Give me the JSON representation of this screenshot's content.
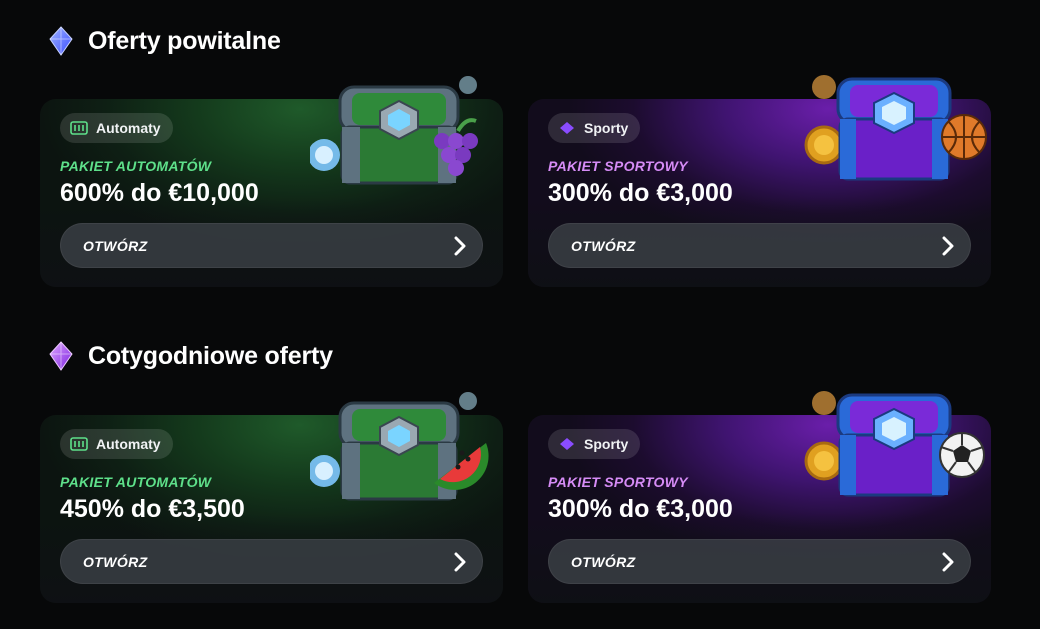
{
  "sections": [
    {
      "title": "Oferty powitalne",
      "gem_color": "#5b7cff",
      "cards": [
        {
          "kind": "slots",
          "badge": "Automaty",
          "package": "PAKIET AUTOMATÓW",
          "amount": "600% do €10,000",
          "button": "OTWÓRZ",
          "fruit": "grapes-icon"
        },
        {
          "kind": "sports",
          "badge": "Sporty",
          "package": "PAKIET SPORTOWY",
          "amount": "300% do €3,000",
          "button": "OTWÓRZ",
          "ball": "basketball-icon"
        }
      ]
    },
    {
      "title": "Cotygodniowe oferty",
      "gem_color": "#a64cff",
      "cards": [
        {
          "kind": "slots",
          "badge": "Automaty",
          "package": "PAKIET AUTOMATÓW",
          "amount": "450% do €3,500",
          "button": "OTWÓRZ",
          "fruit": "watermelon-icon"
        },
        {
          "kind": "sports",
          "badge": "Sporty",
          "package": "PAKIET SPORTOWY",
          "amount": "300% do €3,000",
          "button": "OTWÓRZ",
          "ball": "soccer-ball-icon"
        }
      ]
    }
  ],
  "colors": {
    "slots_accent": "#5ee08a",
    "sports_accent": "#d68cf6",
    "background": "#070809",
    "button_bg": "#3a3e44"
  }
}
